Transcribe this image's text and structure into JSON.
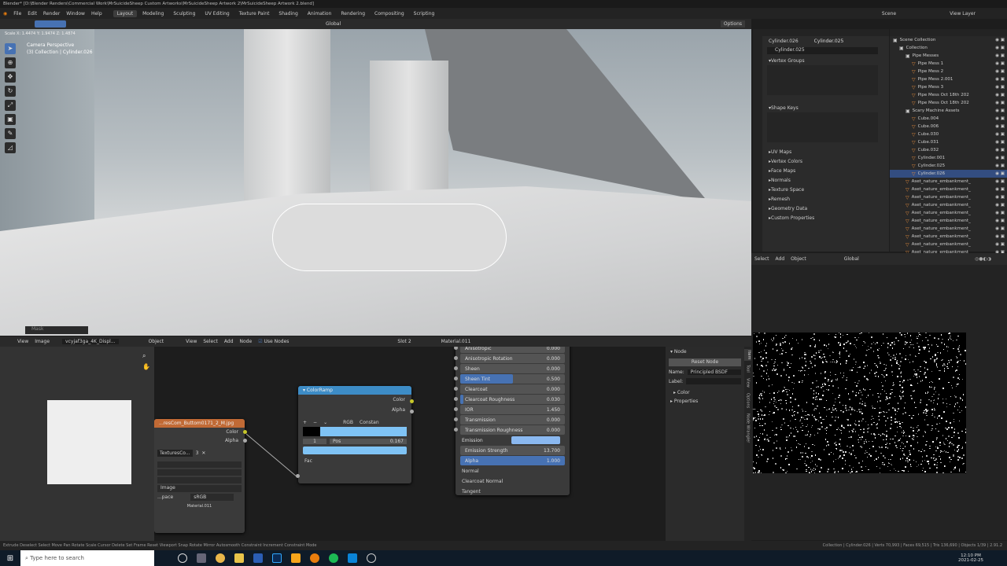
{
  "window": {
    "title": "Blender* [D:\\Blender Renders\\Commercial Work\\MrSuicideSheep Custom Artworks\\MrSuicideSheep Artwork 2\\MrSuicideSheep Artwork 2.blend]"
  },
  "menu": [
    "File",
    "Edit",
    "Render",
    "Window",
    "Help"
  ],
  "workspaces": [
    {
      "label": "Layout",
      "active": true
    },
    {
      "label": "Modeling"
    },
    {
      "label": "Sculpting"
    },
    {
      "label": "UV Editing"
    },
    {
      "label": "Texture Paint"
    },
    {
      "label": "Shading"
    },
    {
      "label": "Animation"
    },
    {
      "label": "Rendering"
    },
    {
      "label": "Compositing"
    },
    {
      "label": "Scripting"
    }
  ],
  "scene": {
    "label": "Scene",
    "view_layer": "View Layer"
  },
  "viewport": {
    "transform_orientation": "Global",
    "options": "Options",
    "scale_readout": "Scale X: 1.4474  Y: 1.9474  Z: 1.4874",
    "view_name": "Camera Perspective",
    "collection_info": "(3) Collection | Cylinder.026",
    "mask_label": "Mask"
  },
  "properties": {
    "object": "Cylinder.026",
    "mesh": "Cylinder.025",
    "mesh_field": "Cylinder.025",
    "sections": [
      "Vertex Groups",
      "Shape Keys"
    ],
    "collapsed": [
      "UV Maps",
      "Vertex Colors",
      "Face Maps",
      "Normals",
      "Texture Space",
      "Remesh",
      "Geometry Data",
      "Custom Properties"
    ]
  },
  "outliner": {
    "items": [
      {
        "label": "Scene Collection",
        "depth": 0,
        "type": "collection"
      },
      {
        "label": "Collection",
        "depth": 1,
        "type": "collection"
      },
      {
        "label": "Pipe Messes",
        "depth": 2,
        "type": "collection"
      },
      {
        "label": "Pipe Mess 1",
        "depth": 3
      },
      {
        "label": "Pipe Mess 2",
        "depth": 3
      },
      {
        "label": "Pipe Mess 2.001",
        "depth": 3
      },
      {
        "label": "Pipe Mess 3",
        "depth": 3
      },
      {
        "label": "Pipe Mess Oct 18th 202",
        "depth": 3
      },
      {
        "label": "Pipe Mess Oct 18th 202",
        "depth": 3
      },
      {
        "label": "Scary Machine Assets",
        "depth": 2,
        "type": "collection"
      },
      {
        "label": "Cube.004",
        "depth": 3
      },
      {
        "label": "Cube.006",
        "depth": 3
      },
      {
        "label": "Cube.030",
        "depth": 3
      },
      {
        "label": "Cube.031",
        "depth": 3
      },
      {
        "label": "Cube.032",
        "depth": 3
      },
      {
        "label": "Cylinder.001",
        "depth": 3
      },
      {
        "label": "Cylinder.025",
        "depth": 3
      },
      {
        "label": "Cylinder.026",
        "depth": 3,
        "selected": true
      },
      {
        "label": "Aset_nature_embankment_",
        "depth": 2
      },
      {
        "label": "Aset_nature_embankment_",
        "depth": 2
      },
      {
        "label": "Aset_nature_embankment_",
        "depth": 2
      },
      {
        "label": "Aset_nature_embankment_",
        "depth": 2
      },
      {
        "label": "Aset_nature_embankment_",
        "depth": 2
      },
      {
        "label": "Aset_nature_embankment_",
        "depth": 2
      },
      {
        "label": "Aset_nature_embankment_",
        "depth": 2
      },
      {
        "label": "Aset_nature_embankment_",
        "depth": 2
      },
      {
        "label": "Aset_nature_embankment_",
        "depth": 2
      },
      {
        "label": "Aset_nature_embankment_",
        "depth": 2
      }
    ]
  },
  "viewport2": {
    "menu": [
      "Select",
      "Add",
      "Object"
    ],
    "orientation": "Global"
  },
  "image_editor": {
    "menu": [
      "View",
      "Image"
    ],
    "image_name": "vcyjaf3ga_4K_Displ..."
  },
  "node_editor": {
    "mode": "Object",
    "menu": [
      "View",
      "Select",
      "Add",
      "Node"
    ],
    "use_nodes": "Use Nodes",
    "slot": "Slot 2",
    "material": "Material.011"
  },
  "image_node": {
    "title": "...resCom_Buttom0171_2_M.jpg",
    "outputs": [
      "Color",
      "Alpha"
    ],
    "image": "TexturesCo...",
    "users": "3",
    "projection": "Image",
    "color_space_label": "...pace",
    "color_space": "sRGB",
    "material": "Material.011"
  },
  "color_ramp": {
    "title": "ColorRamp",
    "outputs": [
      "Color",
      "Alpha"
    ],
    "color_mode": "RGB",
    "interpolation": "Constan",
    "index": "1",
    "pos_label": "Pos",
    "pos": "0.167",
    "input": "Fac",
    "stop_color": "#7fc3f5"
  },
  "bsdf": {
    "rows": [
      {
        "label": "Anisotropic",
        "value": "0.000"
      },
      {
        "label": "Anisotropic Rotation",
        "value": "0.000"
      },
      {
        "label": "Sheen",
        "value": "0.000"
      },
      {
        "label": "Sheen Tint",
        "value": "0.500",
        "fill": 0.5
      },
      {
        "label": "Clearcoat",
        "value": "0.000"
      },
      {
        "label": "Clearcoat Roughness",
        "value": "0.030",
        "fill": 0.03
      },
      {
        "label": "IOR",
        "value": "1.450"
      },
      {
        "label": "Transmission",
        "value": "0.000"
      },
      {
        "label": "Transmission Roughness",
        "value": "0.000"
      }
    ],
    "emission": "Emission",
    "emission_color": "#8ab8f0",
    "emission_strength_label": "Emission Strength",
    "emission_strength": "13.700",
    "alpha_label": "Alpha",
    "alpha": "1.000",
    "inputs": [
      "Normal",
      "Clearcoat Normal",
      "Tangent"
    ]
  },
  "n_panel": {
    "section": "Node",
    "reset": "Reset Node",
    "name_label": "Name:",
    "name": "Principled BSDF",
    "label_label": "Label:",
    "color": "Color",
    "properties": "Properties",
    "tabs": [
      "Item",
      "Tool",
      "View",
      "Options",
      "Node Wrangler"
    ]
  },
  "statusbar": {
    "left": "Extrude  Deselect  Select  Move  Pan  Rotate  Scale  Cursor  Delete  Set Frame  Reset Viewport  Snap  Rotate  Mirror  Autosmooth  Constraint  Increment Constraint Mode",
    "right": "Collection | Cylinder.026 | Verts 70,993 | Faces 69,515 | Tris 136,690 | Objects 1/39 | 2.91.2"
  },
  "taskbar": {
    "search_placeholder": "Type here to search",
    "time": "12:10 PM",
    "date": "2021-02-25"
  }
}
